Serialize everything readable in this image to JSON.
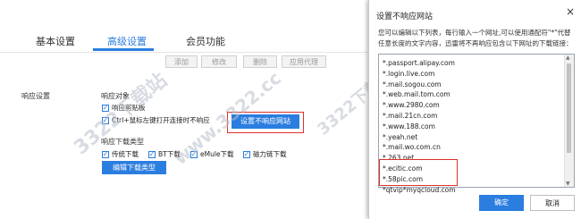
{
  "settings": {
    "tabs": [
      {
        "label": "基本设置"
      },
      {
        "label": "高级设置"
      },
      {
        "label": "会员功能"
      }
    ],
    "toolbar": [
      "添加",
      "修改",
      "删除",
      "应用代理"
    ],
    "section_label": "响应设置",
    "response_target": {
      "title": "响应对象",
      "options": [
        {
          "label": "响应剪贴板",
          "checked": true
        },
        {
          "label": "Ctrl+鼠标左键打开连接时不响应",
          "checked": true
        }
      ],
      "set_button": "设置不响应网站"
    },
    "download_types": {
      "title": "响应下载类型",
      "options": [
        {
          "label": "传统下载",
          "checked": true
        },
        {
          "label": "BT下载",
          "checked": true
        },
        {
          "label": "eMule下载",
          "checked": true
        },
        {
          "label": "磁力链下载",
          "checked": true
        }
      ],
      "edit_button": "编辑下载类型"
    },
    "watermark": "3322下载站",
    "watermark_url": "www.3322.cc"
  },
  "dialog": {
    "title": "设置不响应网站",
    "close": "×",
    "description": "您可以编辑以下列表，每行输入一个网址,可以使用通配符\"*\"代替任意长度的文字内容，迅雷将不再响应包含以下网址的下载链接：",
    "list": [
      "*.passport.alipay.com",
      "*.login.live.com",
      "*.mail.sogou.com",
      "*.web.mail.tom.com",
      "*.www.2980.com",
      "*.mail.21cn.com",
      "*.www.188.com",
      "*.yeah.net",
      "*.mail.wo.com.cn",
      "*.263.net",
      "*.ecitic.com",
      "*.58pic.com",
      "*qtvip*myqcloud.com"
    ],
    "ok": "确定",
    "cancel": "取消"
  },
  "colors": {
    "accent": "#2b7de0",
    "highlight": "#e0302b"
  }
}
